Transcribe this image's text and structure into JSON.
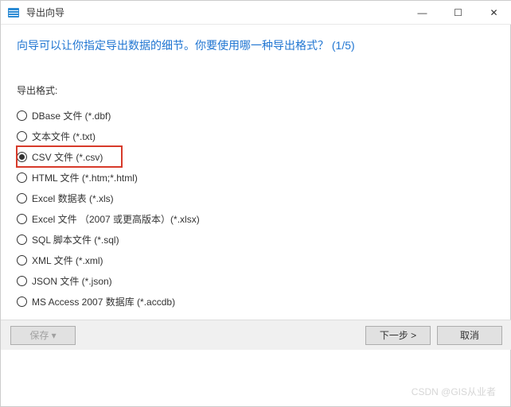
{
  "window": {
    "title": "导出向导",
    "minimize_icon": "—",
    "maximize_icon": "☐",
    "close_icon": "✕"
  },
  "prompt": "向导可以让你指定导出数据的细节。你要使用哪一种导出格式？  (1/5)",
  "format_label": "导出格式:",
  "formats": [
    {
      "label": "DBase 文件 (*.dbf)",
      "selected": false,
      "highlight": false
    },
    {
      "label": "文本文件 (*.txt)",
      "selected": false,
      "highlight": false
    },
    {
      "label": "CSV 文件 (*.csv)",
      "selected": true,
      "highlight": true
    },
    {
      "label": "HTML 文件 (*.htm;*.html)",
      "selected": false,
      "highlight": false
    },
    {
      "label": "Excel 数据表 (*.xls)",
      "selected": false,
      "highlight": false
    },
    {
      "label": "Excel 文件 （2007 或更高版本）(*.xlsx)",
      "selected": false,
      "highlight": false
    },
    {
      "label": "SQL 脚本文件 (*.sql)",
      "selected": false,
      "highlight": false
    },
    {
      "label": "XML 文件 (*.xml)",
      "selected": false,
      "highlight": false
    },
    {
      "label": "JSON 文件 (*.json)",
      "selected": false,
      "highlight": false
    },
    {
      "label": "MS Access 2007 数据库 (*.accdb)",
      "selected": false,
      "highlight": false
    }
  ],
  "footer": {
    "save_label": "保存 ▾",
    "next_label": "下一步 >",
    "cancel_label": "取消"
  },
  "watermark": "CSDN @GIS从业者"
}
